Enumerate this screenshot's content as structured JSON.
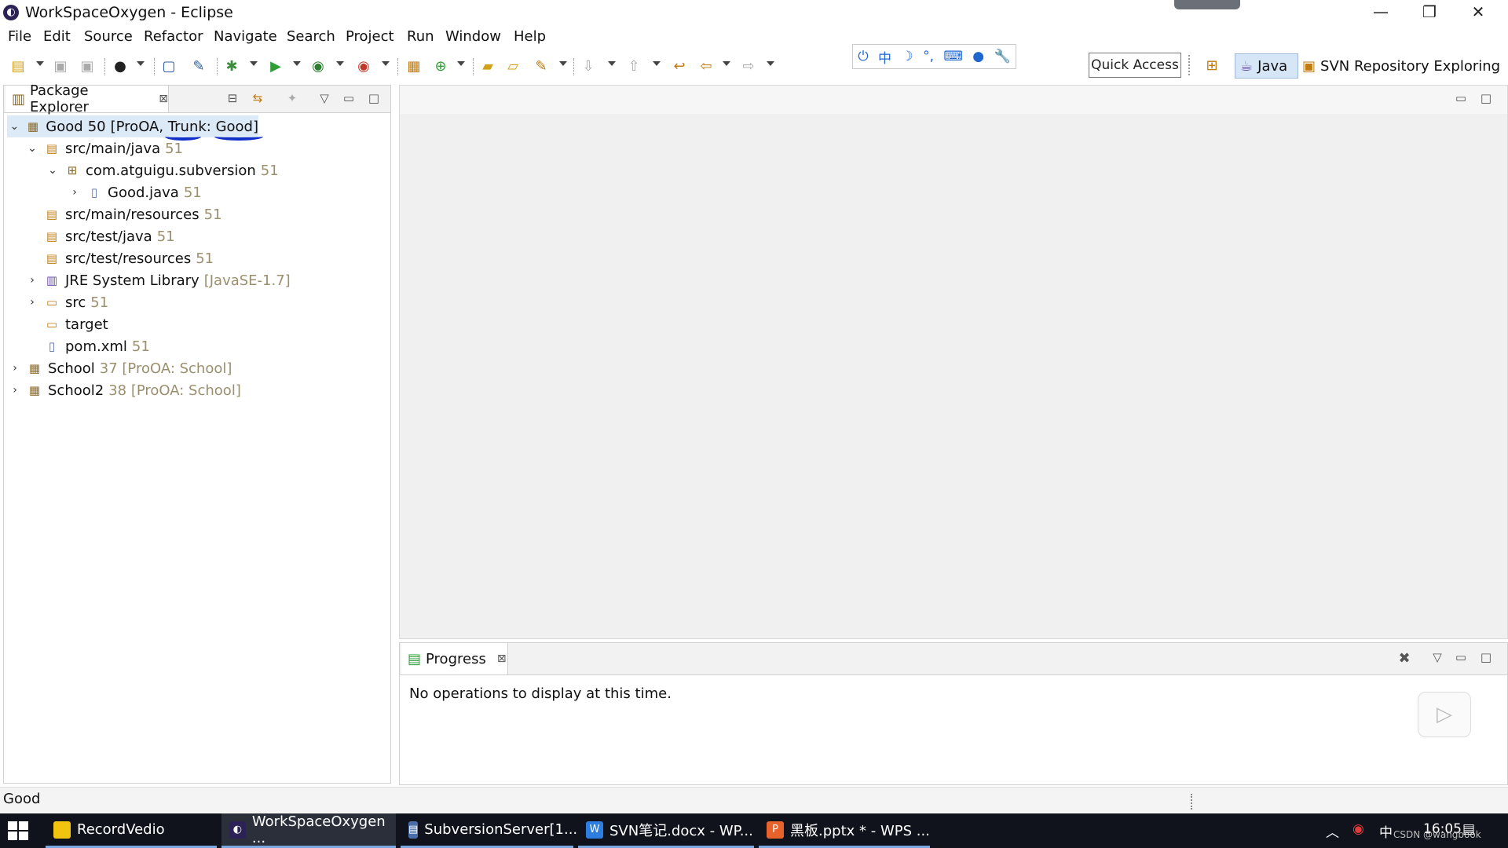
{
  "window": {
    "title": "WorkSpaceOxygen - Eclipse",
    "minimize_glyph": "—",
    "restore_glyph": "❐",
    "close_glyph": "✕"
  },
  "menu": [
    "File",
    "Edit",
    "Source",
    "Refactor",
    "Navigate",
    "Search",
    "Project",
    "Run",
    "Window",
    "Help"
  ],
  "ime": [
    "⏻",
    "中",
    "☽",
    "°,",
    "⌨",
    "●",
    "🔧"
  ],
  "toolbar": {
    "quick_access": "Quick Access",
    "perspectives": [
      {
        "label": "Java",
        "icon": "java-perspective-icon",
        "active": true
      },
      {
        "label": "SVN Repository Exploring",
        "icon": "svn-perspective-icon",
        "active": false
      }
    ]
  },
  "package_explorer": {
    "title": "Package Explorer",
    "tree": [
      {
        "name": "Good",
        "deco": "",
        "rev": "50",
        "suffix": "[ProOA, Trunk: Good]",
        "icon": "project-icon",
        "selected": true,
        "expanded": true
      },
      {
        "name": "src/main/java",
        "rev": "51",
        "icon": "source-folder-icon",
        "expanded": true
      },
      {
        "name": "com.atguigu.subversion",
        "rev": "51",
        "icon": "package-icon",
        "expanded": true
      },
      {
        "name": "Good.java",
        "rev": "51",
        "icon": "java-file-icon",
        "expanded": false
      },
      {
        "name": "src/main/resources",
        "rev": "51",
        "icon": "source-folder-icon"
      },
      {
        "name": "src/test/java",
        "rev": "51",
        "icon": "source-folder-icon"
      },
      {
        "name": "src/test/resources",
        "rev": "51",
        "icon": "source-folder-icon"
      },
      {
        "name": "JRE System Library",
        "rev": "[JavaSE-1.7]",
        "icon": "library-icon",
        "expanded": false
      },
      {
        "name": "src",
        "rev": "51",
        "icon": "folder-icon",
        "expanded": false
      },
      {
        "name": "target",
        "rev": "",
        "icon": "folder-icon"
      },
      {
        "name": "pom.xml",
        "rev": "51",
        "icon": "xml-file-icon"
      },
      {
        "name": "School",
        "rev": "37 [ProOA: School]",
        "icon": "project-icon",
        "expanded": false
      },
      {
        "name": "School2",
        "rev": "38 [ProOA: School]",
        "icon": "project-icon",
        "expanded": false
      }
    ]
  },
  "progress": {
    "title": "Progress",
    "message": "No operations to display at this time."
  },
  "status": {
    "text": "Good"
  },
  "taskbar": {
    "items": [
      {
        "label": "RecordVedio",
        "icon_color": "#f1c40f"
      },
      {
        "label": "WorkSpaceOxygen ...",
        "icon_color": "#2c2255"
      },
      {
        "label": "SubversionServer[1...",
        "icon_color": "#4a6ea9"
      },
      {
        "label": "SVN笔记.docx - WP...",
        "icon_color": "#2e7de1"
      },
      {
        "label": "黑板.pptx * - WPS ...",
        "icon_color": "#e8632b"
      }
    ],
    "tray_ime": "中",
    "clock": "16:05",
    "watermark": "CSDN @wangbook"
  },
  "colors": {
    "selection": "#dce9f7",
    "decoration": "#9b8f6e",
    "annotation_ink": "#1230c8",
    "taskbar": "#10131c"
  }
}
